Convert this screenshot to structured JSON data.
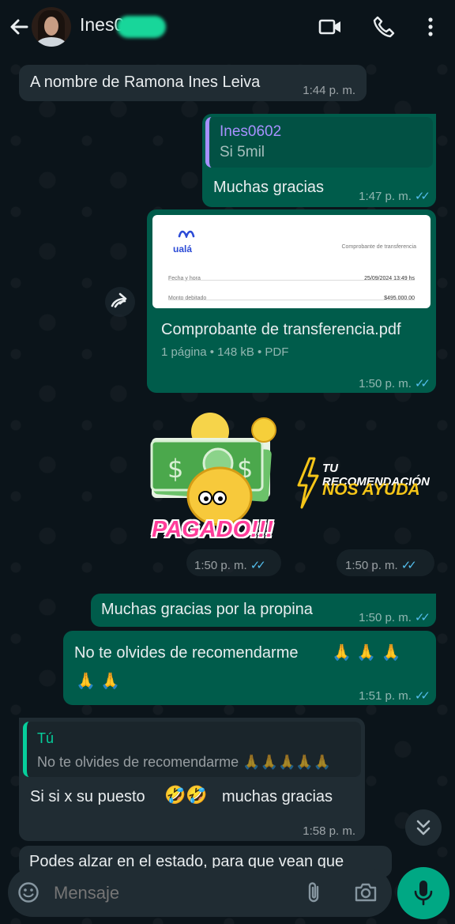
{
  "header": {
    "contact_name": "Ines0",
    "back_icon": "arrow-left-icon",
    "video_icon": "video-call-icon",
    "call_icon": "phone-icon",
    "menu_icon": "more-vertical-icon"
  },
  "messages": [
    {
      "text": "A nombre de Ramona Ines Leiva",
      "time": "1:44 p. m."
    },
    {
      "quote_author": "Ines0602",
      "quote_text": "Si  5mil",
      "text": "Muchas gracias",
      "time": "1:47 p. m."
    },
    {
      "pdf_logo": "ualá",
      "pdf_header": "Comprobante de transferencia",
      "pdf_rows": [
        {
          "label": "Fecha y hora",
          "value": "25/09/2024 13:49 hs"
        },
        {
          "label": "Monto debitado",
          "value": "$495.000,00"
        }
      ],
      "file_name": "Comprobante de transferencia.pdf",
      "file_meta": "1 página • 148 kB • PDF",
      "time": "1:50 p. m."
    },
    {
      "sticker_text": "PAGADO!!!",
      "time": "1:50 p. m."
    },
    {
      "sticker_line1": "TU RECOMENDACIÓN",
      "sticker_line2": "NOS AYUDA",
      "time": "1:50 p. m."
    },
    {
      "text": "Muchas gracias por la propina",
      "time": "1:50 p. m."
    },
    {
      "text": "No te olvides de recomendarme",
      "emoji_tail": "🙏 🙏 🙏",
      "emoji_line2": "🙏 🙏",
      "time": "1:51 p. m."
    },
    {
      "quote_author": "Tú",
      "quote_text": "No te olvides de recomendarme 🙏🙏🙏🙏🙏",
      "text_a": "Si si x su  puesto",
      "text_emoji": "🤣🤣",
      "text_b": "muchas gracias",
      "time": "1:58 p. m."
    },
    {
      "text": "Podes alzar en el estado, para que vean que"
    }
  ],
  "input": {
    "placeholder": "Mensaje",
    "emoji_icon": "emoji-icon",
    "attach_icon": "paperclip-icon",
    "camera_icon": "camera-icon",
    "mic_icon": "microphone-icon"
  },
  "colors": {
    "background": "#0b141a",
    "incoming": "#202c33",
    "outgoing": "#005c4b",
    "read_ticks": "#53bdeb",
    "accent": "#00a884"
  }
}
